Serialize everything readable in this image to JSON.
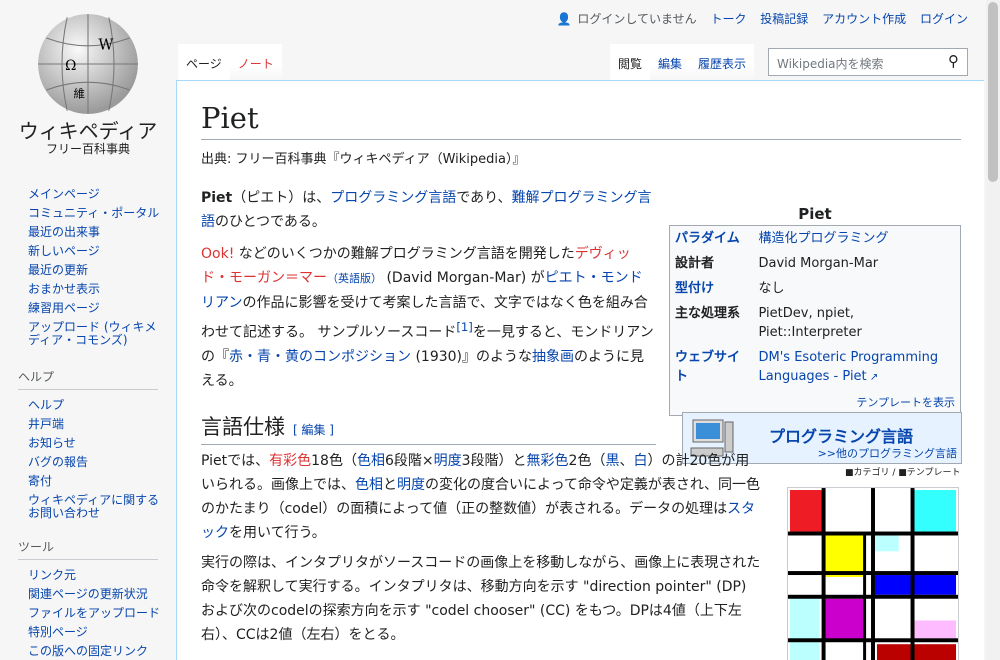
{
  "logo": {
    "wordmark": "ウィキペディア",
    "tagline": "フリー百科事典"
  },
  "personal": {
    "not_logged": "ログインしていません",
    "talk": "トーク",
    "contribs": "投稿記録",
    "create": "アカウント作成",
    "login": "ログイン"
  },
  "tabs": {
    "page": "ページ",
    "note": "ノート",
    "read": "閲覧",
    "edit": "編集",
    "history": "履歴表示"
  },
  "search": {
    "placeholder": "Wikipedia内を検索"
  },
  "nav": [
    "メインページ",
    "コミュニティ・ポータル",
    "最近の出来事",
    "新しいページ",
    "最近の更新",
    "おまかせ表示",
    "練習用ページ",
    "アップロード (ウィキメディア・コモンズ)"
  ],
  "help": {
    "heading": "ヘルプ",
    "items": [
      "ヘルプ",
      "井戸端",
      "お知らせ",
      "バグの報告",
      "寄付",
      "ウィキペディアに関するお問い合わせ"
    ]
  },
  "tools": {
    "heading": "ツール",
    "items": [
      "リンク元",
      "関連ページの更新状況",
      "ファイルをアップロード",
      "特別ページ",
      "この版への固定リンク"
    ]
  },
  "article": {
    "title": "Piet",
    "from": "出典: フリー百科事典『ウィキペディア（Wikipedia）』",
    "p1": {
      "a": "Piet",
      "b": "（ピエト）は、",
      "c": "プログラミング言語",
      "d": "であり、",
      "e": "難解プログラミング言語",
      "f": "のひとつである。"
    },
    "p2": {
      "a": "Ook!",
      "b": " などのいくつかの難解プログラミング言語を開発した",
      "c": "デヴィッド・モーガン＝マー",
      "d": "（英語版）",
      "e": " (David Morgan-Mar) が",
      "f": "ピエト・モンドリアン",
      "g": "の作品に影響を受けて考案した言語で、文字ではなく色を組み合わせて記述する。 サンプルソースコード",
      "h": "[1]",
      "i": "を一見すると、モンドリアンの『",
      "j": "赤・青・黄のコンポジション",
      "k": " (1930)』のような",
      "l": "抽象画",
      "m": "のように見える。"
    },
    "section": "言語仕様",
    "section_edit": "[ 編集 ]",
    "p3": {
      "a": "Pietでは、",
      "b": "有彩色",
      "c": "18色（",
      "d": "色相",
      "e": "6段階×",
      "f": "明度",
      "g": "3段階）と",
      "h": "無彩色",
      "i": "2色（",
      "j": "黒",
      "k": "、",
      "l": "白",
      "m": "）の計20色が用いられる。画像上では、",
      "n": "色相",
      "o": "と",
      "p": "明度",
      "q": "の変化の度合いによって命令や定義が表され、同一色のかたまり（codel）の面積によって値（正の整数値）が表される。データの処理は",
      "r": "スタック",
      "s": "を用いて行う。"
    },
    "p4": "実行の際は、インタプリタがソースコードの画像上を移動しながら、画像上に表現された命令を解釈して実行する。インタプリタは、移動方向を示す \"direction pointer\" (DP) および次のcodelの探索方向を示す \"codel chooser\" (CC) をもつ。DPは4値（上下左右）、CCは2値（左右）をとる。"
  },
  "infobox": {
    "caption": "Piet",
    "rows": [
      {
        "k": "パラダイム",
        "v": "構造化プログラミング"
      },
      {
        "k": "設計者",
        "v": "David Morgan-Mar"
      },
      {
        "k": "型付け",
        "v": "なし"
      },
      {
        "k": "主な処理系",
        "v": "PietDev, npiet, Piet::Interpreter"
      },
      {
        "k": "ウェブサイト",
        "v": "DM's Esoteric Programming Languages - Piet"
      }
    ],
    "template": "テンプレートを表示"
  },
  "portal": {
    "title": "プログラミング言語",
    "other": ">>他のプログラミング言語",
    "footer": "■カテゴリ / ■テンプレート"
  }
}
